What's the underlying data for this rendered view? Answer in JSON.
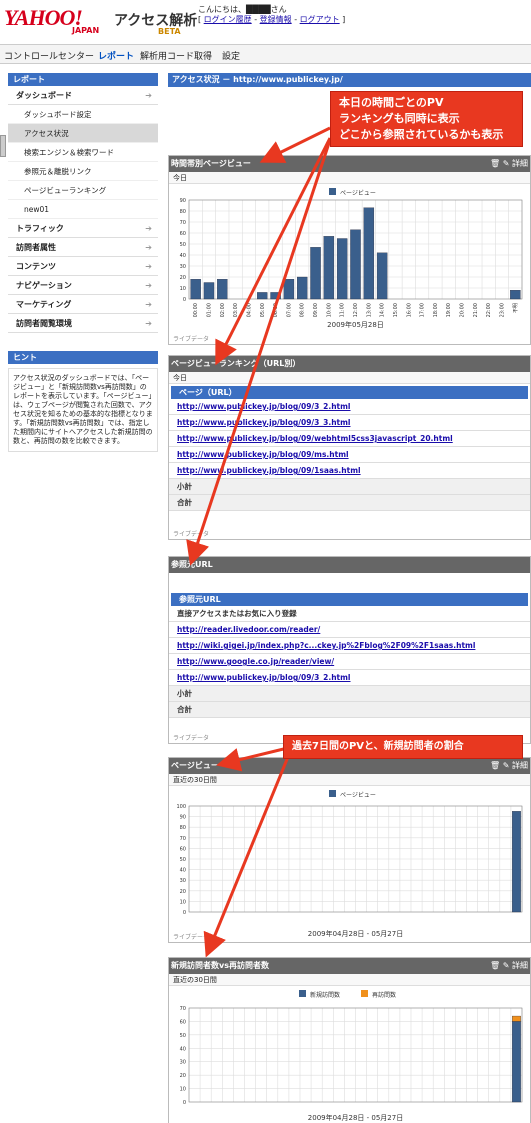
{
  "header": {
    "logo": "YAHOO!",
    "logo_sub": "JAPAN",
    "product": "アクセス解析",
    "beta": "BETA",
    "greeting": "こんにちは、████さん",
    "links": [
      "ログイン履歴",
      "登録情報",
      "ログアウト"
    ]
  },
  "nav": {
    "items": [
      "コントロールセンター",
      "レポート",
      "解析用コード取得",
      "設定"
    ],
    "selected": "レポート"
  },
  "sidebar": {
    "header": "レポート",
    "items": [
      {
        "label": "ダッシュボード",
        "type": "group"
      },
      {
        "label": "ダッシュボード設定",
        "type": "sub"
      },
      {
        "label": "アクセス状況",
        "type": "sub",
        "selected": true
      },
      {
        "label": "検索エンジン＆検索ワード",
        "type": "sub"
      },
      {
        "label": "参照元＆離脱リンク",
        "type": "sub"
      },
      {
        "label": "ページビューランキング",
        "type": "sub"
      },
      {
        "label": "new01",
        "type": "sub"
      },
      {
        "label": "トラフィック",
        "type": "group"
      },
      {
        "label": "訪問者属性",
        "type": "group"
      },
      {
        "label": "コンテンツ",
        "type": "group"
      },
      {
        "label": "ナビゲーション",
        "type": "group"
      },
      {
        "label": "マーケティング",
        "type": "group"
      },
      {
        "label": "訪問者閲覧環境",
        "type": "group"
      }
    ],
    "hint_header": "ヒント",
    "hint_text": "アクセス状況のダッシュボードでは、「ページビュー」と「新規訪問数vs再訪問数」のレポートを表示しています。「ページビュー」は、ウェブページが閲覧された回数で、アクセス状況を知るための基本的な指標となります。「新規訪問数vs再訪問数」では、指定した期間内にサイトへアクセスした新規訪問の数と、再訪問の数を比較できます。"
  },
  "main": {
    "title": "アクセス状況 － http://www.publickey.jp/"
  },
  "callouts": {
    "top": [
      "本日の時間ごとのPV",
      "ランキングも同時に表示",
      "どこから参照されているかも表示"
    ],
    "mid": "過去7日間のPVと、新規訪問者の割合"
  },
  "panels": {
    "hourly": {
      "title": "時間帯別ページビュー",
      "tools": "詳細",
      "sub": "今日",
      "footer": "ライブデータ"
    },
    "ranking": {
      "title": "ページビューランキング（URL別）",
      "sub": "今日",
      "col": "ページ（URL）",
      "rows": [
        "http://www.publickey.jp/blog/09/3_2.html",
        "http://www.publickey.jp/blog/09/3_3.html",
        "http://www.publickey.jp/blog/09/webhtml5css3javascript_20.html",
        "http://www.publickey.jp/blog/09/ms.html",
        "http://www.publickey.jp/blog/09/1saas.html"
      ],
      "subtotal": "小計",
      "total": "合計",
      "footer": "ライブデータ"
    },
    "referrer": {
      "title": "参照元URL",
      "col": "参照元URL",
      "rows": [
        "直接アクセスまたはお気に入り登録",
        "http://reader.livedoor.com/reader/",
        "http://wiki.gigei.jp/index.php?c...ckey.jp%2Fblog%2F09%2F1saas.html",
        "http://www.google.co.jp/reader/view/",
        "http://www.publickey.jp/blog/09/3_2.html"
      ],
      "subtotal": "小計",
      "total": "合計",
      "footer": "ライブデータ"
    },
    "pv30": {
      "title": "ページビュー",
      "tools": "詳細",
      "sub": "直近の30日間",
      "footer": "ライブデータ"
    },
    "newret": {
      "title": "新規訪問者数vs再訪問者数",
      "tools": "詳細",
      "sub": "直近の30日間"
    }
  },
  "chart_data": [
    {
      "type": "bar",
      "title": "",
      "legend": [
        "ページビュー"
      ],
      "xlabel": "2009年05月28日",
      "ylim": [
        0,
        90
      ],
      "categories": [
        "00:00",
        "01:00",
        "02:00",
        "03:00",
        "04:00",
        "05:00",
        "06:00",
        "07:00",
        "08:00",
        "09:00",
        "10:00",
        "11:00",
        "12:00",
        "13:00",
        "14:00",
        "15:00",
        "16:00",
        "17:00",
        "18:00",
        "19:00",
        "20:00",
        "21:00",
        "22:00",
        "23:00",
        "不明"
      ],
      "series": [
        {
          "name": "ページビュー",
          "values": [
            18,
            15,
            18,
            0,
            0,
            6,
            6,
            18,
            20,
            47,
            57,
            55,
            63,
            83,
            42,
            0,
            0,
            0,
            0,
            0,
            0,
            0,
            0,
            0,
            8
          ]
        }
      ]
    },
    {
      "type": "bar",
      "legend": [
        "ページビュー"
      ],
      "xlabel": "2009年04月28日 - 05月27日",
      "ylim": [
        0,
        100
      ],
      "series": [
        {
          "name": "ページビュー",
          "values": [
            0,
            0,
            0,
            0,
            0,
            0,
            0,
            0,
            0,
            0,
            0,
            0,
            0,
            0,
            0,
            0,
            0,
            0,
            0,
            0,
            0,
            0,
            0,
            0,
            0,
            0,
            0,
            0,
            0,
            95
          ]
        }
      ]
    },
    {
      "type": "bar",
      "legend": [
        "新規訪問数",
        "再訪問数"
      ],
      "xlabel": "2009年04月28日 - 05月27日",
      "ylim": [
        0,
        70
      ],
      "series": [
        {
          "name": "新規訪問数",
          "values": [
            0,
            0,
            0,
            0,
            0,
            0,
            0,
            0,
            0,
            0,
            0,
            0,
            0,
            0,
            0,
            0,
            0,
            0,
            0,
            0,
            0,
            0,
            0,
            0,
            0,
            0,
            0,
            0,
            0,
            60
          ]
        },
        {
          "name": "再訪問数",
          "values": [
            0,
            0,
            0,
            0,
            0,
            0,
            0,
            0,
            0,
            0,
            0,
            0,
            0,
            0,
            0,
            0,
            0,
            0,
            0,
            0,
            0,
            0,
            0,
            0,
            0,
            0,
            0,
            0,
            0,
            4
          ]
        }
      ]
    }
  ],
  "colors": {
    "accent": "#3b6fc2",
    "bar": "#3a5f8c",
    "callout": "#e83820",
    "retvisit": "#f0901c"
  }
}
